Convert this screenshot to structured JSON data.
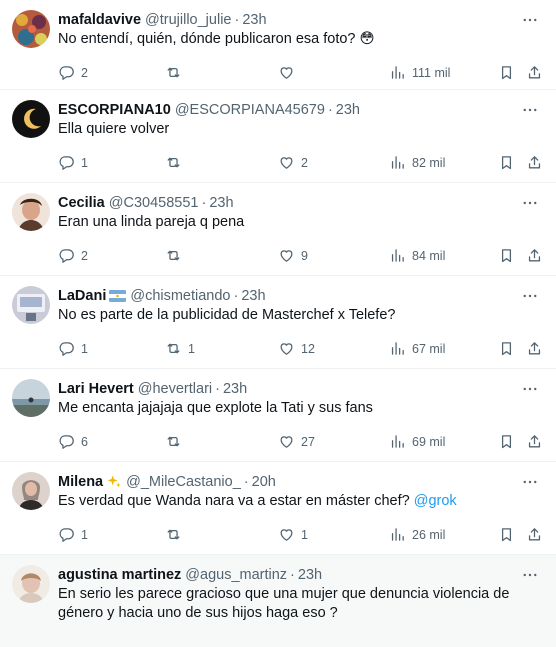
{
  "replies": [
    {
      "name": "mafaldavive",
      "badge": "",
      "handle": "@trujillo_julie",
      "time": "23h",
      "text": "No entendí, quién, dónde publicaron esa foto? 😳",
      "mention": "",
      "replies": "2",
      "retweets": "",
      "likes": "",
      "views": "111 mil",
      "avatar_color": "#b45b3e"
    },
    {
      "name": "ESCORPIANA10",
      "badge": "",
      "handle": "@ESCORPIANA45679",
      "time": "23h",
      "text": "Ella quiere volver",
      "mention": "",
      "replies": "1",
      "retweets": "",
      "likes": "2",
      "views": "82 mil",
      "avatar_color": "#111111"
    },
    {
      "name": "Cecilia",
      "badge": "",
      "handle": "@C30458551",
      "time": "23h",
      "text": "Eran una linda pareja q pena",
      "mention": "",
      "replies": "2",
      "retweets": "",
      "likes": "9",
      "views": "84 mil",
      "avatar_color": "#d9a58a"
    },
    {
      "name": "LaDani",
      "badge": "argentina-flag-icon",
      "handle": "@chismetiando",
      "time": "23h",
      "text": "No es parte de la publicidad de Masterchef x Telefe?",
      "mention": "",
      "replies": "1",
      "retweets": "1",
      "likes": "12",
      "views": "67 mil",
      "avatar_color": "#c9ccd6"
    },
    {
      "name": "Lari Hevert",
      "badge": "",
      "handle": "@hevertlari",
      "time": "23h",
      "text": "Me encanta jajajaja que explote la Tati y sus fans",
      "mention": "",
      "replies": "6",
      "retweets": "",
      "likes": "27",
      "views": "69 mil",
      "avatar_color": "#7f98a8"
    },
    {
      "name": "Milena",
      "badge": "sparkles-icon",
      "handle": "@_MileCastanio_",
      "time": "20h",
      "text": "Es verdad que Wanda nara va a estar en máster chef? ",
      "mention": "@grok",
      "replies": "1",
      "retweets": "",
      "likes": "1",
      "views": "26 mil",
      "avatar_color": "#8a7a74"
    },
    {
      "name": "agustina martinez",
      "badge": "",
      "handle": "@agus_martinz",
      "time": "23h",
      "text": "En serio les parece gracioso que una mujer que denuncia violencia de género y hacia uno de sus hijos haga eso ?",
      "mention": "",
      "replies": "",
      "retweets": "",
      "likes": "",
      "views": "",
      "avatar_color": "#e2c2b3"
    }
  ],
  "colors": {
    "text": "#0f1419",
    "secondary": "#536471",
    "link": "#1d9bf0",
    "divider": "#eff3f4"
  }
}
